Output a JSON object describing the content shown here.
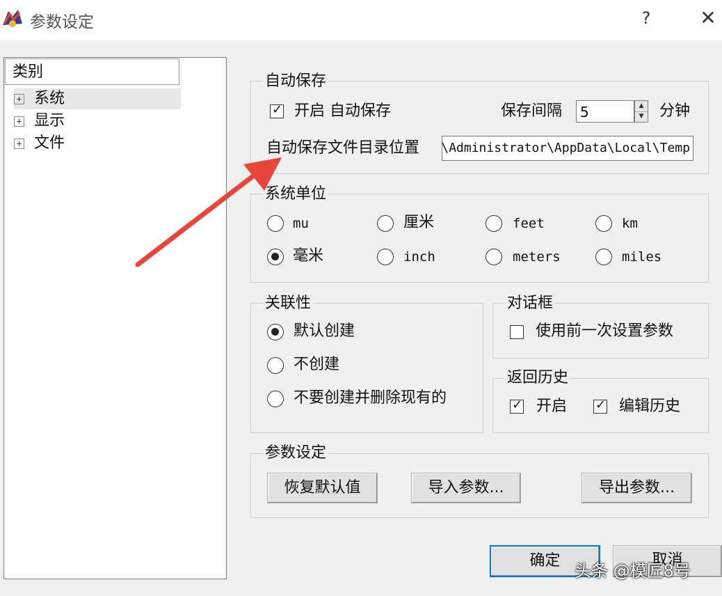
{
  "window": {
    "title": "参数设定",
    "help": "?",
    "close": "✕"
  },
  "tree": {
    "header": "类别",
    "items": [
      {
        "label": "系统",
        "selected": true
      },
      {
        "label": "显示",
        "selected": false
      },
      {
        "label": "文件",
        "selected": false
      }
    ]
  },
  "autosave": {
    "title": "自动保存",
    "enable_label": "开启 自动保存",
    "enabled": true,
    "interval_label": "保存间隔",
    "interval_value": "5",
    "interval_unit": "分钟",
    "dir_label": "自动保存文件目录位置",
    "dir_value": "C:\\Users\\Administrator\\AppData\\Local\\Temp"
  },
  "units": {
    "title": "系统单位",
    "options": [
      "mu",
      "厘米",
      "feet",
      "km",
      "毫米",
      "inch",
      "meters",
      "miles"
    ],
    "selected": "毫米"
  },
  "association": {
    "title": "关联性",
    "options": [
      "默认创建",
      "不创建",
      "不要创建并删除现有的"
    ],
    "selected": "默认创建"
  },
  "dialog": {
    "title": "对话框",
    "use_previous_label": "使用前一次设置参数",
    "use_previous": false
  },
  "history": {
    "title": "返回历史",
    "enable_label": "开启",
    "enabled": true,
    "edit_label": "编辑历史",
    "edit_enabled": true
  },
  "params": {
    "title": "参数设定",
    "restore_label": "恢复默认值",
    "import_label": "导入参数...",
    "export_label": "导出参数..."
  },
  "footer": {
    "ok_label": "确定",
    "cancel_label": "取消"
  },
  "watermark": "头条 @模匠8号",
  "colors": {
    "arrow": "#e8453c",
    "default_button_border": "#0078d7"
  }
}
